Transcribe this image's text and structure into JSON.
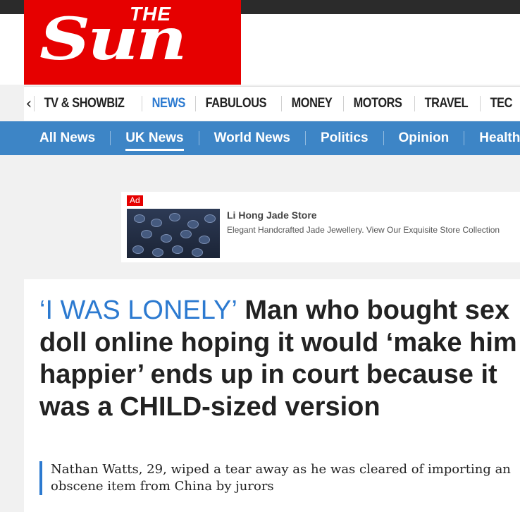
{
  "brand": {
    "the": "THE",
    "sun": "Sun",
    "color": "#e60000"
  },
  "primary_nav": {
    "back_icon": "chevron-left-icon",
    "items": [
      {
        "label": "TV & SHOWBIZ"
      },
      {
        "label": "NEWS",
        "active": true
      },
      {
        "label": "FABULOUS"
      },
      {
        "label": "MONEY"
      },
      {
        "label": "MOTORS"
      },
      {
        "label": "TRAVEL"
      },
      {
        "label": "TEC"
      }
    ]
  },
  "secondary_nav": {
    "items": [
      {
        "label": "All News"
      },
      {
        "label": "UK News",
        "active": true
      },
      {
        "label": "World News"
      },
      {
        "label": "Politics"
      },
      {
        "label": "Opinion"
      },
      {
        "label": "Health"
      }
    ]
  },
  "ad": {
    "badge": "Ad",
    "title": "Li Hong Jade Store",
    "description": "Elegant Handcrafted Jade Jewellery. View Our Exquisite Store Collection"
  },
  "article": {
    "kicker": "‘I WAS LONELY’",
    "headline_part1": " Man who bought sex doll online hoping it would ",
    "headline_quote": "‘make him happier’",
    "headline_part2": " ends up in court because it was a CHILD-sized version",
    "standfirst": "Nathan Watts, 29, wiped a tear away as he was cleared of importing an obscene item from China by jurors"
  },
  "colors": {
    "accent": "#2c7ad0",
    "subnav": "#3d85c6",
    "topbar": "#2b2b2b"
  }
}
